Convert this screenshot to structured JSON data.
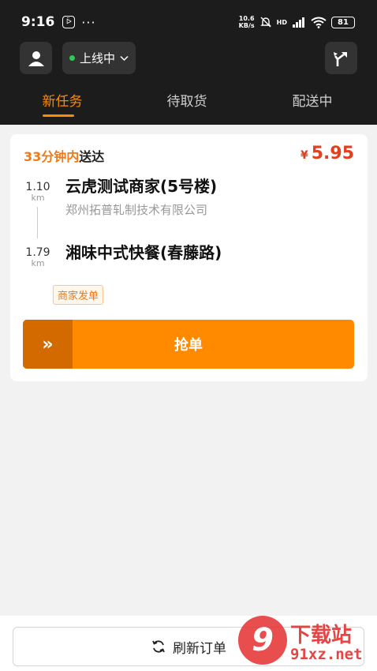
{
  "status_bar": {
    "time": "9:16",
    "app_badge": "ᐇ",
    "more": "···",
    "net_speed_value": "10.6",
    "net_speed_unit": "KB/s",
    "network": "HD",
    "battery": "81"
  },
  "header": {
    "online_status": "上线中",
    "status_color": "#34c759"
  },
  "tabs": [
    {
      "label": "新任务",
      "active": true
    },
    {
      "label": "待取货",
      "active": false
    },
    {
      "label": "配送中",
      "active": false
    }
  ],
  "order": {
    "eta_highlight": "33分钟内",
    "eta_suffix": "送达",
    "currency": "¥",
    "price": "5.95",
    "pickup": {
      "distance": "1.10",
      "unit": "km",
      "name": "云虎测试商家(5号楼)",
      "sub": "郑州拓普轧制技术有限公司"
    },
    "dropoff": {
      "distance": "1.79",
      "unit": "km",
      "name": "湘味中式快餐(春藤路)"
    },
    "tag": "商家发单",
    "grab_label": "抢单",
    "grab_icon": "»"
  },
  "footer": {
    "refresh_label": "刷新订单"
  },
  "watermark": {
    "logo": "9",
    "title": "下载站",
    "url": "91xz.net"
  },
  "colors": {
    "accent": "#ff8a00",
    "price": "#e53e1c",
    "topbar": "#1c1c1c"
  }
}
